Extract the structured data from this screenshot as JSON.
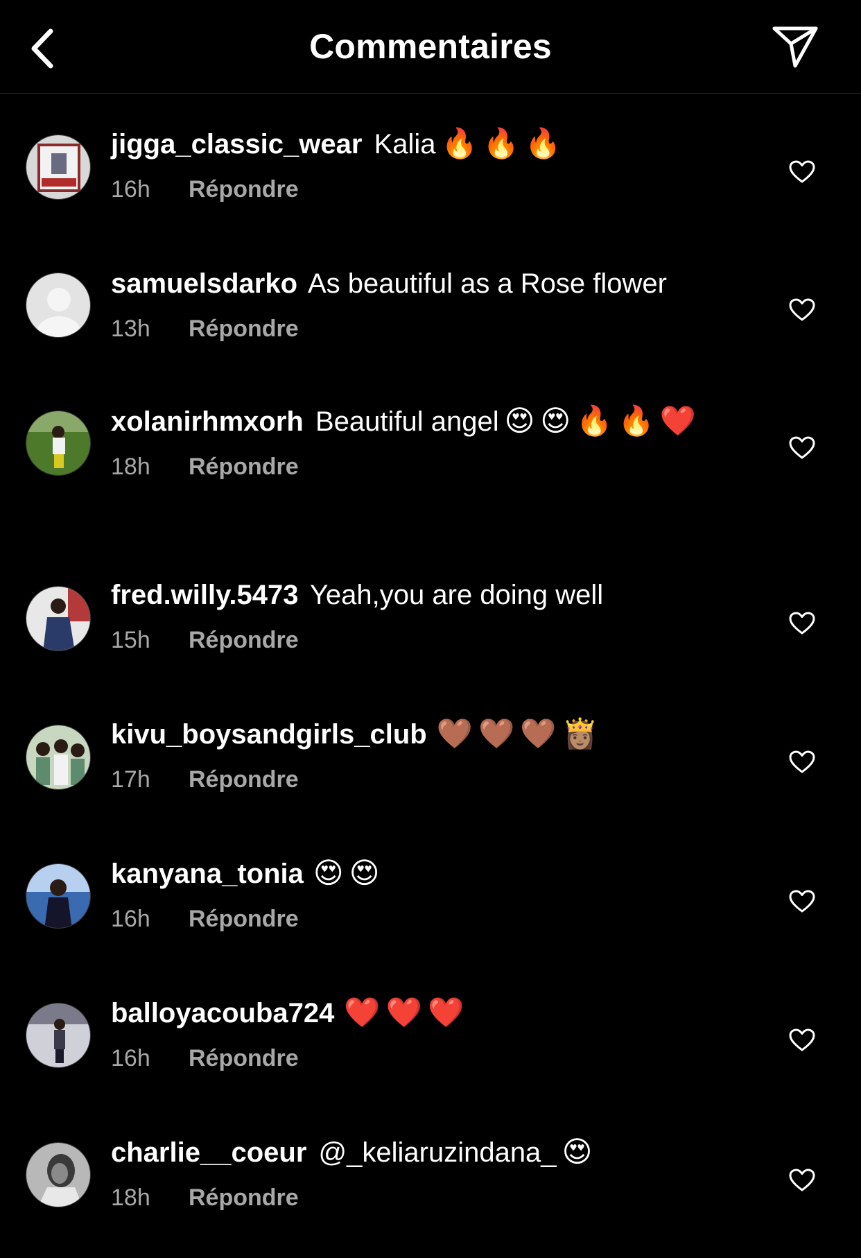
{
  "header": {
    "title": "Commentaires"
  },
  "comments": [
    {
      "username": "jigga_classic_wear",
      "text": "Kalia",
      "emojis": [
        "🔥",
        "🔥",
        "🔥"
      ],
      "time": "16h",
      "reply": "Répondre",
      "avatar_color": "#8a2b2b"
    },
    {
      "username": "samuelsdarko",
      "text": "As beautiful as a Rose flower",
      "emojis": [],
      "time": "13h",
      "reply": "Répondre",
      "avatar_color": "#dcdcdc"
    },
    {
      "username": "xolanirhmxorh",
      "text": "Beautiful angel",
      "emojis": [
        "😍",
        "😍",
        "🔥",
        "🔥",
        "❤️"
      ],
      "time": "18h",
      "reply": "Répondre",
      "avatar_color": "#4c7a2a"
    },
    {
      "username": "fred.willy.5473",
      "text": "Yeah,you are doing well",
      "emojis": [],
      "time": "15h",
      "reply": "Répondre",
      "avatar_color": "#2a3b6a"
    },
    {
      "username": "kivu_boysandgirls_club",
      "text": "",
      "emojis": [
        "🤎",
        "🤎",
        "🤎",
        "👸🏽"
      ],
      "time": "17h",
      "reply": "Répondre",
      "avatar_color": "#5e8a6e"
    },
    {
      "username": "kanyana_tonia",
      "text": "",
      "emojis": [
        "😍",
        "😍"
      ],
      "time": "16h",
      "reply": "Répondre",
      "avatar_color": "#3a6ab0"
    },
    {
      "username": "balloyacouba724",
      "text": "",
      "emojis": [
        "❤️",
        "❤️",
        "❤️"
      ],
      "time": "16h",
      "reply": "Répondre",
      "avatar_color": "#7a7a8a"
    },
    {
      "username": "charlie__coeur",
      "text": "@_keliaruzindana_",
      "emojis": [
        "😍"
      ],
      "time": "18h",
      "reply": "Répondre",
      "avatar_color": "#9a9a9a"
    }
  ]
}
